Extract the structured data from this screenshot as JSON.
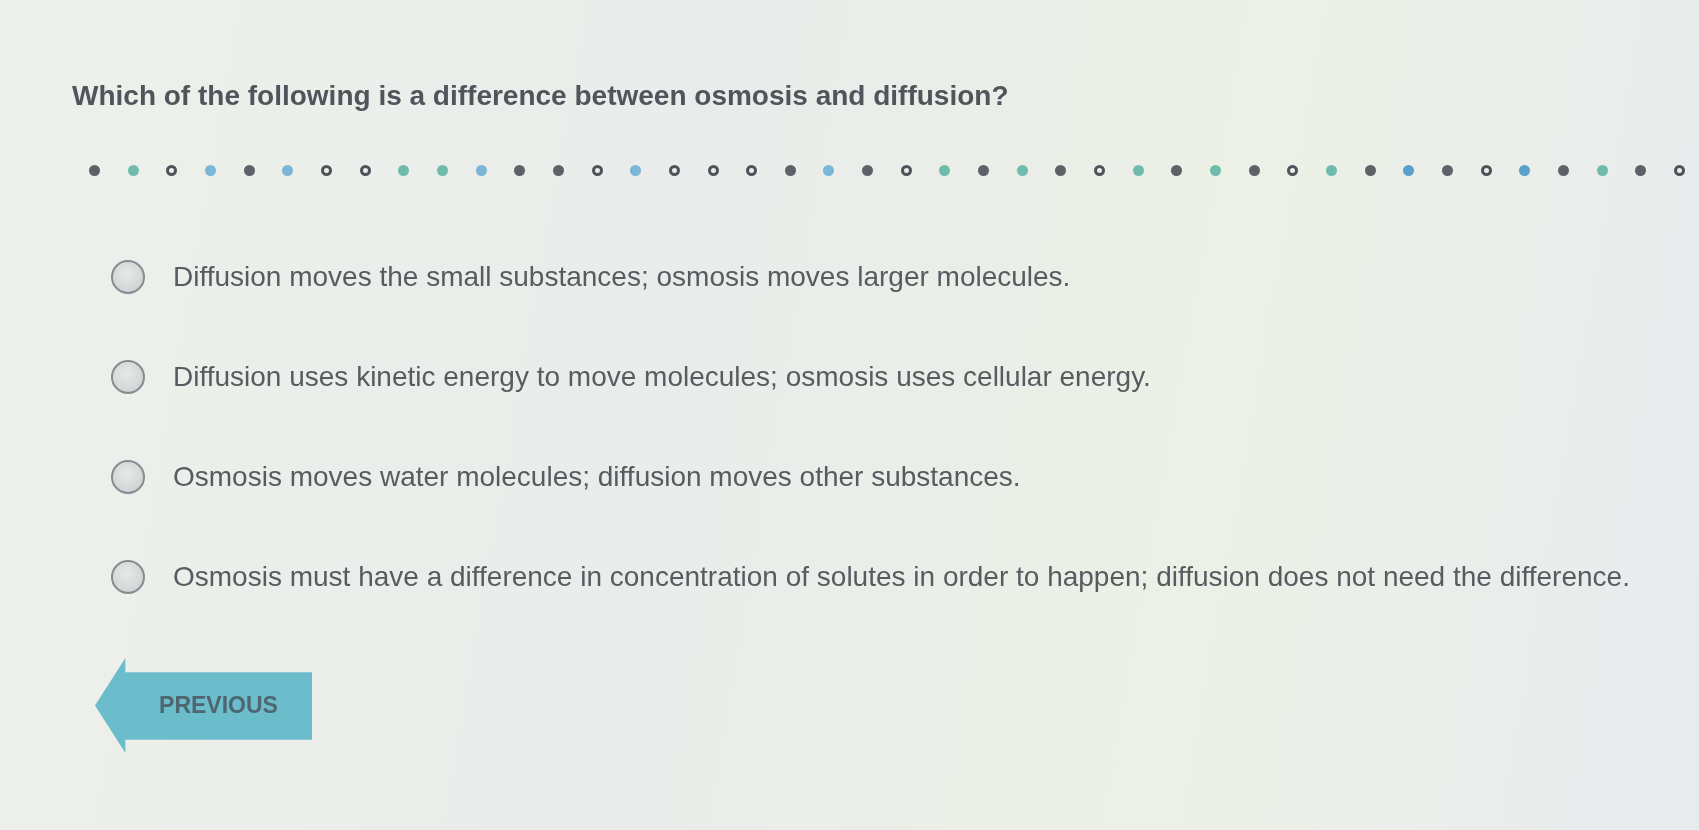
{
  "question": {
    "text": "Which of the following is a difference between osmosis and diffusion?"
  },
  "progress_dots": [
    {
      "kind": "filled",
      "color": "#5e6168"
    },
    {
      "kind": "filled",
      "color": "#6fbcae"
    },
    {
      "kind": "ring",
      "color": "#4e5259"
    },
    {
      "kind": "filled",
      "color": "#7ab6d6"
    },
    {
      "kind": "filled",
      "color": "#5e6168"
    },
    {
      "kind": "filled",
      "color": "#7ab6d6"
    },
    {
      "kind": "ring",
      "color": "#4e5259"
    },
    {
      "kind": "ring",
      "color": "#4e5259"
    },
    {
      "kind": "filled",
      "color": "#6fbcae"
    },
    {
      "kind": "filled",
      "color": "#6fbcae"
    },
    {
      "kind": "filled",
      "color": "#7ab6d6"
    },
    {
      "kind": "filled",
      "color": "#5e6168"
    },
    {
      "kind": "filled",
      "color": "#5e6168"
    },
    {
      "kind": "ring",
      "color": "#4e5259"
    },
    {
      "kind": "filled",
      "color": "#7ab6d6"
    },
    {
      "kind": "ring",
      "color": "#4e5259"
    },
    {
      "kind": "ring",
      "color": "#4e5259"
    },
    {
      "kind": "ring",
      "color": "#4e5259"
    },
    {
      "kind": "filled",
      "color": "#5e6168"
    },
    {
      "kind": "filled",
      "color": "#7ab6d6"
    },
    {
      "kind": "filled",
      "color": "#5e6168"
    },
    {
      "kind": "ring",
      "color": "#4e5259"
    },
    {
      "kind": "filled",
      "color": "#6fbcae"
    },
    {
      "kind": "filled",
      "color": "#5e6168"
    },
    {
      "kind": "filled",
      "color": "#6fbcae"
    },
    {
      "kind": "filled",
      "color": "#5e6168"
    },
    {
      "kind": "ring",
      "color": "#4e5259"
    },
    {
      "kind": "filled",
      "color": "#6fbcae"
    },
    {
      "kind": "filled",
      "color": "#5e6168"
    },
    {
      "kind": "filled",
      "color": "#6fbcae"
    },
    {
      "kind": "filled",
      "color": "#5e6168"
    },
    {
      "kind": "ring",
      "color": "#4e5259"
    },
    {
      "kind": "filled",
      "color": "#6fbcae"
    },
    {
      "kind": "filled",
      "color": "#5e6168"
    },
    {
      "kind": "filled",
      "color": "#5aa0cc"
    },
    {
      "kind": "filled",
      "color": "#5e6168"
    },
    {
      "kind": "ring",
      "color": "#4e5259"
    },
    {
      "kind": "filled",
      "color": "#5aa0cc"
    },
    {
      "kind": "filled",
      "color": "#5e6168"
    },
    {
      "kind": "filled",
      "color": "#6fbcae"
    },
    {
      "kind": "filled",
      "color": "#5e6168"
    },
    {
      "kind": "ring",
      "color": "#4e5259"
    }
  ],
  "options": [
    {
      "text": "Diffusion moves the small substances; osmosis moves larger molecules.",
      "selected": false
    },
    {
      "text": "Diffusion uses kinetic energy to move molecules; osmosis uses cellular energy.",
      "selected": false
    },
    {
      "text": "Osmosis moves water molecules; diffusion moves other substances.",
      "selected": false
    },
    {
      "text": "Osmosis must have a difference in concentration of solutes in order to happen; diffusion does not need the difference.",
      "selected": false
    }
  ],
  "previous_button": {
    "label": "PREVIOUS"
  }
}
